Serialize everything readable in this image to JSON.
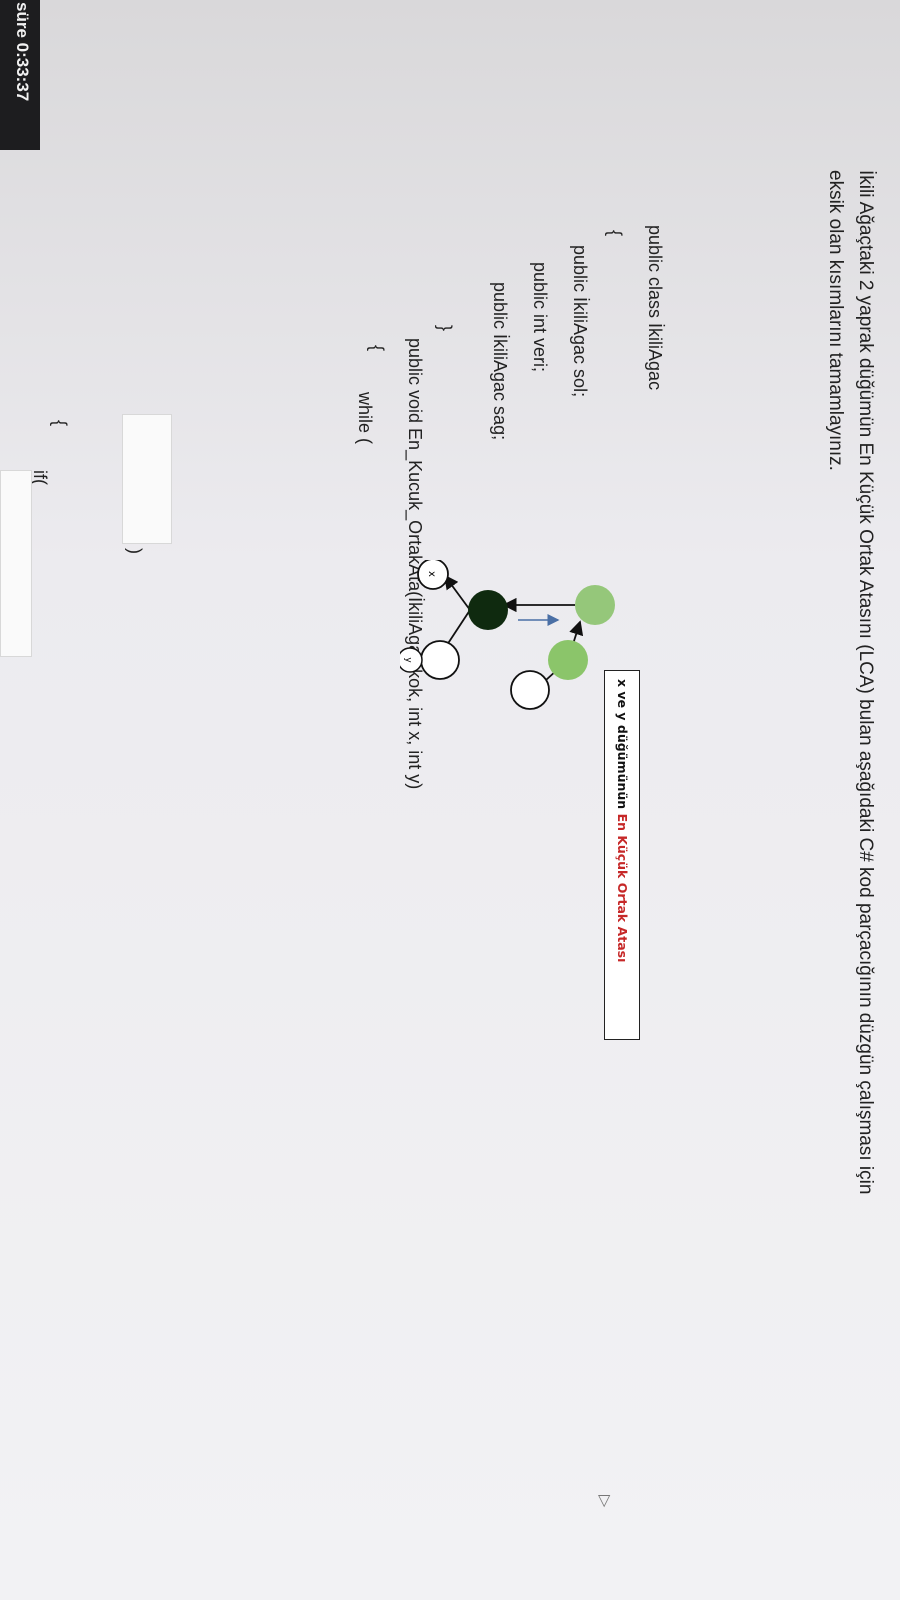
{
  "timer": {
    "label": "süre",
    "value": "0:33:37"
  },
  "question": {
    "line1": "İkili Ağaçtaki 2 yaprak düğümün En Küçük Ortak Atasını (LCA) bulan aşağıdaki C# kod parçacığının düzgün çalışması için",
    "line2": "eksik olan kısımlarını tamamlayınız."
  },
  "code": {
    "class_decl": "public class İkiliAgac",
    "open_brace": "{",
    "field_left": "public İkiliAgac sol;",
    "field_value": "public int veri;",
    "field_right": "public İkiliAgac sag;",
    "close_brace": "}",
    "method_decl": "public void En_Kucuk_OrtakAta(İkiliAgac kok, int x, int y)",
    "method_open_brace": "{",
    "while_label": "while (",
    "while_close": ")",
    "inner_open_brace": "{",
    "if_label": "if("
  },
  "diagram": {
    "node_x_label": "x",
    "node_y_label": "y",
    "caption_prefix": "x ve y düğümünün ",
    "caption_highlight": "En Küçük Ortak Atası",
    "colors": {
      "root": "#8bc56a",
      "mid": "#95c77a",
      "lca": "#0f2a0f",
      "highlight": "#c62828"
    }
  }
}
